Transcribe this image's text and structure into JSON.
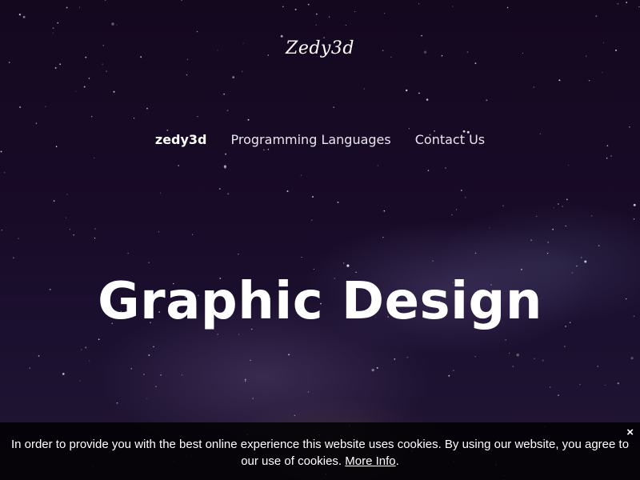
{
  "site": {
    "logo": "Zedy3d"
  },
  "nav": {
    "items": [
      {
        "label": "zedy3d",
        "active": true
      },
      {
        "label": "Programming Languages",
        "active": false
      },
      {
        "label": "Contact Us",
        "active": false
      }
    ]
  },
  "hero": {
    "title": "Graphic Design"
  },
  "cookie_notice": {
    "text": "In order to provide you with the best online experience this website uses cookies. By using our website, you agree to our use of cookies.",
    "link_label": "More Info",
    "trailing": ".",
    "close_label": "×"
  },
  "colors": {
    "background": "#140a22",
    "text": "#ffffff",
    "cookie_bar": "#000000"
  }
}
